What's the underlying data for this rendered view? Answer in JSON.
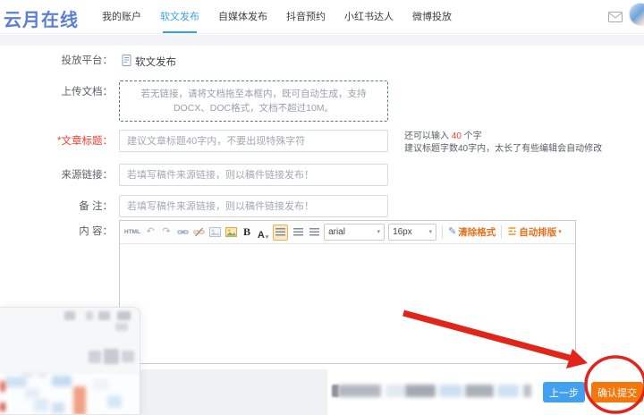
{
  "brand": {
    "name": "云月在线"
  },
  "nav": {
    "items": [
      {
        "label": "我的账户"
      },
      {
        "label": "软文发布"
      },
      {
        "label": "自媒体发布"
      },
      {
        "label": "抖音预约"
      },
      {
        "label": "小红书达人"
      },
      {
        "label": "微博投放"
      }
    ]
  },
  "form": {
    "platform": {
      "label": "投放平台：",
      "value": "软文发布"
    },
    "upload": {
      "label": "上传文档：",
      "hint": "若无链接，请将文档拖至本框内，既可自动生成，支持DOCX、DOC格式，文档不超过10M。"
    },
    "title": {
      "label": "*文章标题：",
      "placeholder": "建议文章标题40字内，不要出现特殊字符",
      "counter_prefix": "还可以输入 ",
      "counter_count": "40",
      "counter_suffix": " 个字",
      "counter_note": "建议标题字数40字内，太长了有些编辑会自动修改"
    },
    "source": {
      "label": "来源链接：",
      "placeholder": "若填写稿件来源链接，则以稿件链接发布！"
    },
    "remark": {
      "label": "备 注：",
      "placeholder": "若填写稿件来源链接，则以稿件链接发布！"
    },
    "content": {
      "label": "内 容："
    }
  },
  "editor": {
    "html_label": "HTML",
    "bold_label": "B",
    "font_color_label": "A",
    "font_family": "arial",
    "font_size": "16px",
    "clear_format": "清除格式",
    "auto_format": "自动排版"
  },
  "footer": {
    "prev_button": "上一步",
    "submit_button": "确认提交"
  },
  "icons": {
    "undo": "↶",
    "redo": "↷",
    "caret_down": "▾",
    "pen": "✎"
  },
  "colors": {
    "brand_blue": "#5b7fd6",
    "accent_blue": "#3aa1e8",
    "button_blue": "#41a1ef",
    "button_orange": "#f3770b",
    "annotation_red": "#e1251b",
    "required_red": "#f04134"
  }
}
